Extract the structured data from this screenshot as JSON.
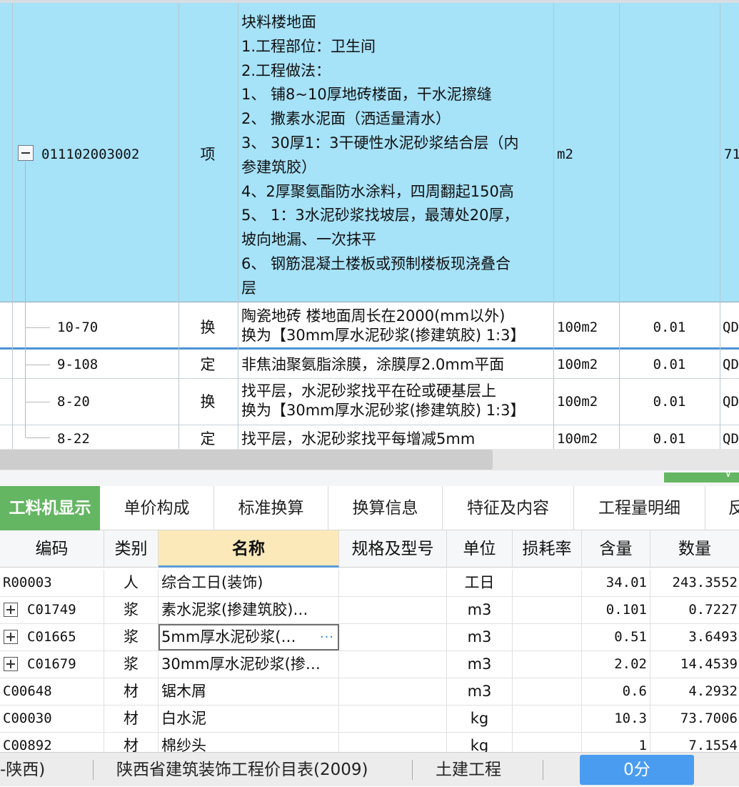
{
  "upper": {
    "main": {
      "code": "011102003002",
      "type": "项",
      "unit": "m2",
      "qty_partial": "71",
      "description": [
        "块料楼地面",
        "1.工程部位：卫生间",
        "2.工程做法：",
        "1、 铺8~10厚地砖楼面，干水泥擦缝",
        "2、 撒素水泥面（洒适量清水）",
        "3、 30厚1：3干硬性水泥砂浆结合层（内",
        "参建筑胶）",
        "4、2厚聚氨酯防水涂料，四周翻起150高",
        "5、 1：3水泥砂浆找坡层，最薄处20厚，",
        "坡向地漏、一次抹平",
        "6、 钢筋混凝土楼板或预制楼板现浇叠合",
        "层"
      ]
    },
    "subrows": [
      {
        "code": "10-70",
        "type": "换",
        "name1": "陶瓷地砖 楼地面周长在2000(mm以外)",
        "name2": "换为【30mm厚水泥砂浆(掺建筑胶) 1:3】",
        "unit": "100m2",
        "qty": "0.01",
        "extra": "QD"
      },
      {
        "code": "9-108",
        "type": "定",
        "name1": "非焦油聚氨脂涂膜，涂膜厚2.0mm平面",
        "name2": "",
        "unit": "100m2",
        "qty": "0.01",
        "extra": "QD"
      },
      {
        "code": "8-20",
        "type": "换",
        "name1": "找平层，水泥砂浆找平在砼或硬基层上",
        "name2": "换为【30mm厚水泥砂浆(掺建筑胶) 1:3】",
        "unit": "100m2",
        "qty": "0.01",
        "extra": "QD"
      },
      {
        "code": "8-22",
        "type": "定",
        "name1": "找平层，水泥砂浆找平每增减5mm",
        "name2": "",
        "unit": "100m2",
        "qty": "0.01",
        "extra": "QD"
      }
    ]
  },
  "tabs": [
    "工料机显示",
    "单价构成",
    "标准换算",
    "换算信息",
    "特征及内容",
    "工程量明细",
    "反"
  ],
  "lower": {
    "headers": [
      "编码",
      "类别",
      "名称",
      "规格及型号",
      "单位",
      "损耗率",
      "含量",
      "数量"
    ],
    "rows": [
      {
        "code": "R00003",
        "cat": "人",
        "name": "综合工日(装饰)",
        "spec": "",
        "unit": "工日",
        "loss": "",
        "content": "34.01",
        "qty": "243.3552",
        "expand": false
      },
      {
        "code": "C01749",
        "cat": "浆",
        "name": "素水泥浆(掺建筑胶)…",
        "spec": "",
        "unit": "m3",
        "loss": "",
        "content": "0.101",
        "qty": "0.7227",
        "expand": true
      },
      {
        "code": "C01665",
        "cat": "浆",
        "name": "5mm厚水泥砂浆(…",
        "spec": "",
        "unit": "m3",
        "loss": "",
        "content": "0.51",
        "qty": "3.6493",
        "expand": true,
        "editing": true
      },
      {
        "code": "C01679",
        "cat": "浆",
        "name": "30mm厚水泥砂浆(掺…",
        "spec": "",
        "unit": "m3",
        "loss": "",
        "content": "2.02",
        "qty": "14.4539",
        "expand": true
      },
      {
        "code": "C00648",
        "cat": "材",
        "name": "锯木屑",
        "spec": "",
        "unit": "m3",
        "loss": "",
        "content": "0.6",
        "qty": "4.2932",
        "expand": false
      },
      {
        "code": "C00030",
        "cat": "材",
        "name": "白水泥",
        "spec": "",
        "unit": "kg",
        "loss": "",
        "content": "10.3",
        "qty": "73.7006",
        "expand": false
      },
      {
        "code": "C00892",
        "cat": "材",
        "name": "棉纱头",
        "spec": "",
        "unit": "kg",
        "loss": "",
        "content": "1",
        "qty": "7.1554",
        "expand": false
      }
    ]
  },
  "statusbar": {
    "item1": "-陕西)",
    "item2": "陕西省建筑装饰工程价目表(2009)",
    "item3": "土建工程",
    "score": "0分"
  }
}
